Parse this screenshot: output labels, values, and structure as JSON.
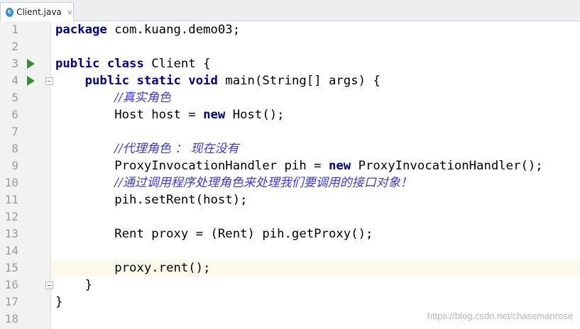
{
  "tab": {
    "icon_letter": "c",
    "filename": "Client.java",
    "close_glyph": "×"
  },
  "gutter": {
    "line_numbers": [
      "1",
      "2",
      "3",
      "4",
      "5",
      "6",
      "7",
      "8",
      "9",
      "10",
      "11",
      "12",
      "13",
      "14",
      "15",
      "16",
      "17",
      "18"
    ],
    "run_lines": [
      3,
      4
    ],
    "fold_lines": [
      4,
      16
    ]
  },
  "editor": {
    "current_line": 15,
    "lines": [
      [
        {
          "t": "package",
          "c": "kw"
        },
        {
          "t": " com.kuang.demo03;"
        }
      ],
      [],
      [
        {
          "t": "public",
          "c": "kw"
        },
        {
          "t": " "
        },
        {
          "t": "class",
          "c": "kw"
        },
        {
          "t": " Client {"
        }
      ],
      [
        {
          "t": "    "
        },
        {
          "t": "public",
          "c": "kw"
        },
        {
          "t": " "
        },
        {
          "t": "static",
          "c": "kw"
        },
        {
          "t": " "
        },
        {
          "t": "void",
          "c": "kw"
        },
        {
          "t": " main(String[] args) {"
        }
      ],
      [
        {
          "t": "        "
        },
        {
          "t": "//真实角色",
          "c": "cm"
        }
      ],
      [
        {
          "t": "        Host host = "
        },
        {
          "t": "new",
          "c": "kw"
        },
        {
          "t": " Host();"
        }
      ],
      [],
      [
        {
          "t": "        "
        },
        {
          "t": "//代理角色 ： 现在没有",
          "c": "cm"
        }
      ],
      [
        {
          "t": "        ProxyInvocationHandler pih = "
        },
        {
          "t": "new",
          "c": "kw"
        },
        {
          "t": " ProxyInvocationHandler();"
        }
      ],
      [
        {
          "t": "        "
        },
        {
          "t": "//通过调用程序处理角色来处理我们要调用的接口对象！",
          "c": "cm"
        }
      ],
      [
        {
          "t": "        pih.setRent(host);"
        }
      ],
      [],
      [
        {
          "t": "        Rent proxy = (Rent) pih.getProxy();"
        }
      ],
      [],
      [
        {
          "t": "        proxy.rent();"
        }
      ],
      [
        {
          "t": "    }"
        }
      ],
      [
        {
          "t": "}"
        }
      ],
      []
    ]
  },
  "watermark": "https://blog.csdn.net/chasemanrose",
  "colors": {
    "keyword": "#000080",
    "comment": "#3d3dcc",
    "current_line_bg": "#fcfaed",
    "run_icon": "#3b8a3b"
  }
}
